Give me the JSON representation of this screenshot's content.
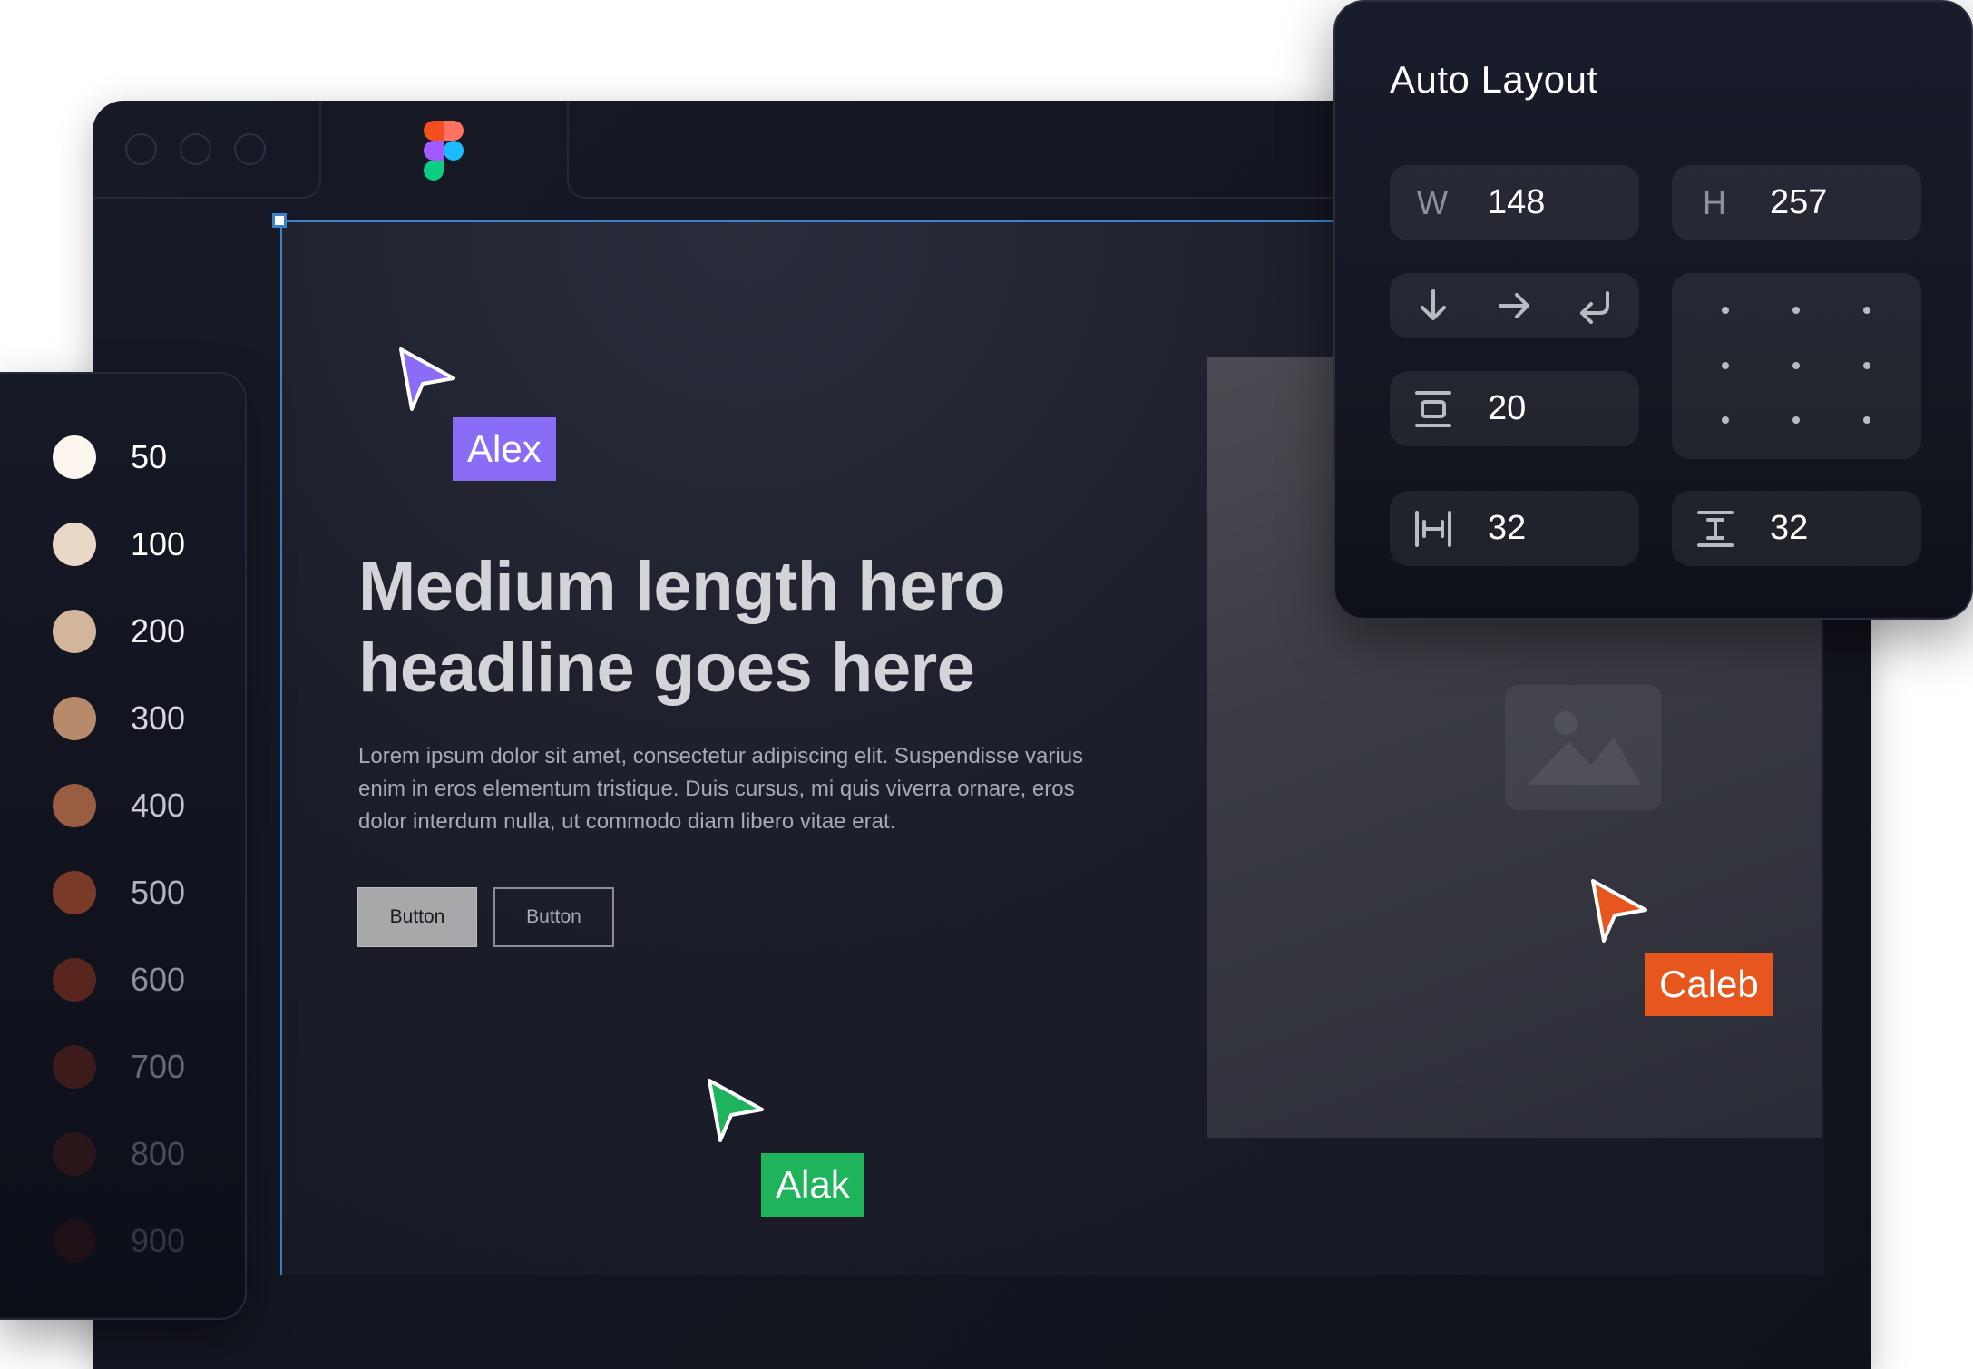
{
  "canvas": {
    "hero": {
      "headline": "Medium length hero headline goes here",
      "body": "Lorem ipsum dolor sit amet, consectetur adipiscing elit. Suspendisse varius enim in eros elementum tristique. Duis cursus, mi quis viverra ornare, eros dolor interdum nulla, ut commodo diam libero vitae erat.",
      "primary_button": "Button",
      "secondary_button": "Button"
    }
  },
  "cursors": [
    {
      "name": "Alex",
      "color": "#8b6cf6"
    },
    {
      "name": "Alak",
      "color": "#1fb35c"
    },
    {
      "name": "Caleb",
      "color": "#e8561f"
    }
  ],
  "palette": [
    {
      "label": "50",
      "color": "#fdf6ef",
      "text_color": "#ffffff"
    },
    {
      "label": "100",
      "color": "#ead8c6",
      "text_color": "#ffffff"
    },
    {
      "label": "200",
      "color": "#d2b59b",
      "text_color": "#eeeeee"
    },
    {
      "label": "300",
      "color": "#b88a6c",
      "text_color": "#d8d8dc"
    },
    {
      "label": "400",
      "color": "#995d41",
      "text_color": "#c4c5ca"
    },
    {
      "label": "500",
      "color": "#7a3a28",
      "text_color": "#b1b3ba"
    },
    {
      "label": "600",
      "color": "#58261d",
      "text_color": "#8e9099"
    },
    {
      "label": "700",
      "color": "#3c1b1a",
      "text_color": "#676a75"
    },
    {
      "label": "800",
      "color": "#2a1518",
      "text_color": "#4a4d59"
    },
    {
      "label": "900",
      "color": "#1d1016",
      "text_color": "#343743"
    }
  ],
  "auto_layout": {
    "title": "Auto Layout",
    "width": {
      "key": "W",
      "value": "148"
    },
    "height": {
      "key": "H",
      "value": "257"
    },
    "spacing": {
      "value": "20"
    },
    "padding_horizontal": {
      "value": "32"
    },
    "padding_vertical": {
      "value": "32"
    }
  }
}
